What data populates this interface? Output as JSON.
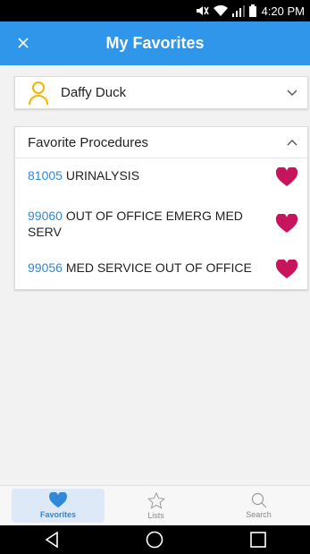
{
  "status_bar": {
    "time": "4:20 PM"
  },
  "app_bar": {
    "title": "My Favorites"
  },
  "patient": {
    "name": "Daffy Duck"
  },
  "favorites": {
    "header": "Favorite Procedures",
    "items": [
      {
        "code": "81005",
        "description": "URINALYSIS"
      },
      {
        "code": "99060",
        "description": "OUT OF OFFICE EMERG MED SERV"
      },
      {
        "code": "99056",
        "description": "MED SERVICE OUT OF OFFICE"
      }
    ]
  },
  "bottom_nav": {
    "items": [
      {
        "label": "Favorites",
        "icon": "heart-icon",
        "active": true
      },
      {
        "label": "Lists",
        "icon": "star-icon",
        "active": false
      },
      {
        "label": "Search",
        "icon": "search-icon",
        "active": false
      }
    ]
  },
  "colors": {
    "primary": "#2f96e9",
    "link": "#2f88d8",
    "heart": "#c8145c",
    "avatar": "#f5b400"
  }
}
